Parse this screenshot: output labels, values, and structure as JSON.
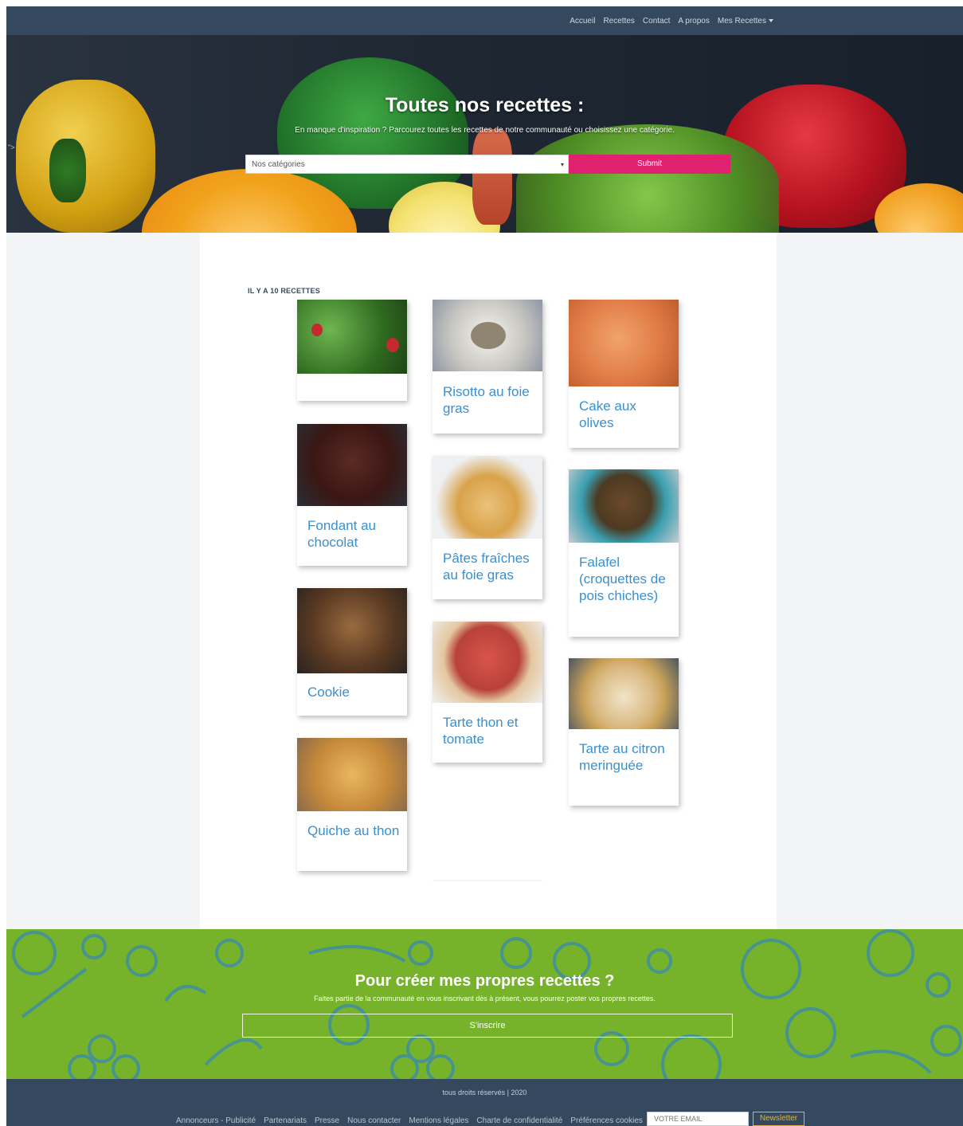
{
  "nav": {
    "items": [
      {
        "label": "Accueil"
      },
      {
        "label": "Recettes"
      },
      {
        "label": "Contact"
      },
      {
        "label": "A propos"
      },
      {
        "label": "Mes Recettes"
      }
    ]
  },
  "hero": {
    "title": "Toutes nos recettes :",
    "subtitle": "En manque d'inspiration ? Parcourez toutes les recettes de notre communauté ou choisissez une catégorie.",
    "select_value": "Nos catégories",
    "submit_label": "Submit",
    "stray_text": "\">"
  },
  "recipes": {
    "count_label": "IL Y A 10 RECETTES",
    "items": [
      {
        "title": "",
        "image": "strawberry-plant"
      },
      {
        "title": "Risotto au foie gras",
        "image": "risotto"
      },
      {
        "title": "Cake aux olives",
        "image": "olive-cake"
      },
      {
        "title": "Fondant au chocolat",
        "image": "chocolate-cake"
      },
      {
        "title": "Pâtes fraîches au foie gras",
        "image": "pasta"
      },
      {
        "title": "Falafel (croquettes de pois chiches)",
        "image": "falafel"
      },
      {
        "title": "Cookie",
        "image": "cookies"
      },
      {
        "title": "Tarte thon et tomate",
        "image": "tomato-tart"
      },
      {
        "title": "Tarte au citron meringuée",
        "image": "lemon-tart"
      },
      {
        "title": "Quiche au thon",
        "image": "quiche"
      }
    ]
  },
  "cta": {
    "title": "Pour créer mes propres recettes ?",
    "subtitle": "Faites partie de la communauté en vous inscrivant dès à présent, vous pourrez poster vos propres recettes.",
    "button_label": "S'inscrire"
  },
  "footer": {
    "copyright": "tous droits réservés | 2020",
    "links": [
      {
        "label": "Annonceurs - Publicité"
      },
      {
        "label": "Partenariats"
      },
      {
        "label": "Presse"
      },
      {
        "label": "Nous contacter"
      },
      {
        "label": "Mentions légales"
      },
      {
        "label": "Charte de confidentialité"
      },
      {
        "label": "Préférences cookies"
      }
    ],
    "email_placeholder": "VOTRE EMAIL",
    "newsletter_label": "Newsletter"
  },
  "colors": {
    "nav_bg": "#34495e",
    "accent_pink": "#e0216f",
    "recipe_link": "#3a8fcf",
    "cta_green": "#76b32b",
    "newsletter_gold": "#e5b233"
  }
}
